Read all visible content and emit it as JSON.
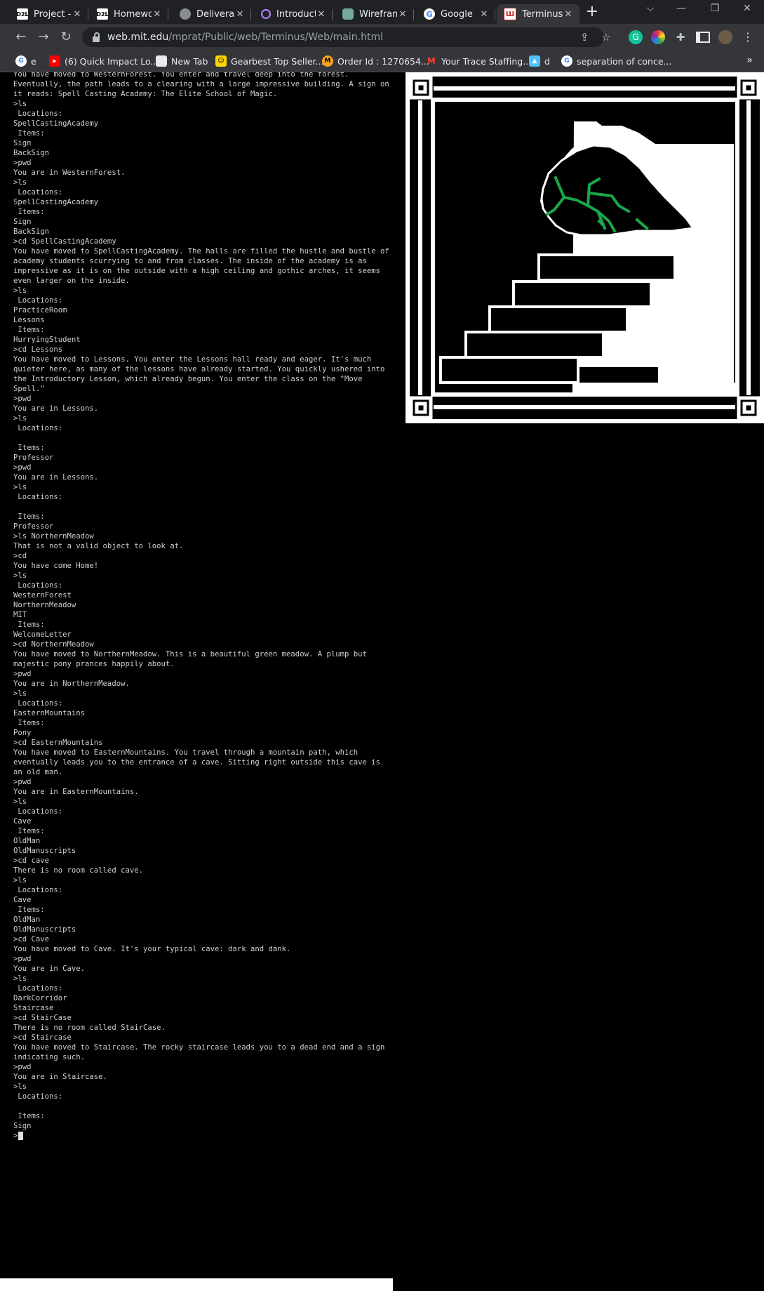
{
  "browser": {
    "tabs": [
      {
        "label": "Project - I",
        "favicon": "D2L",
        "active": false
      },
      {
        "label": "Homewo",
        "favicon": "D2L",
        "active": false
      },
      {
        "label": "Deliverab",
        "favicon": "globe-icon",
        "active": false
      },
      {
        "label": "Introducti",
        "favicon": "openai-icon",
        "active": false
      },
      {
        "label": "Wirefram",
        "favicon": "openai-icon",
        "active": false
      },
      {
        "label": "Google",
        "favicon": "google-icon",
        "active": false
      },
      {
        "label": "Terminus",
        "favicon": "terminus-icon",
        "active": true
      }
    ],
    "new_tab": "+",
    "url_host": "web.mit.edu",
    "url_path": "/mprat/Public/web/Terminus/Web/main.html",
    "bookmarks": [
      {
        "label": "e",
        "icon": "google-icon"
      },
      {
        "label": "(6) Quick Impact Lo...",
        "icon": "youtube-icon"
      },
      {
        "label": "New Tab",
        "icon": "page-icon"
      },
      {
        "label": "Gearbest Top Seller...",
        "icon": "gearbest-icon"
      },
      {
        "label": "Order Id : 1270654...",
        "icon": "m-icon"
      },
      {
        "label": "Your Trace Staffing...",
        "icon": "gmail-icon"
      },
      {
        "label": "d",
        "icon": "hat-icon"
      },
      {
        "label": "separation of conce...",
        "icon": "google-icon"
      }
    ],
    "bookmarks_more": "»",
    "colors": {
      "tabstrip": "#202124",
      "toolbar": "#35363a",
      "accent_green": "#1aa64a"
    }
  },
  "terminal": {
    "lines": [
      "You have moved to WesternForest. You enter and travel deep into the forest. Eventually, the path leads to a clearing with a large impressive building. A sign on it reads: Spell Casting Academy: The Elite School of Magic.",
      ">ls",
      " Locations:",
      "SpellCastingAcademy",
      " Items:",
      "Sign",
      "BackSign",
      ">pwd",
      "You are in WesternForest.",
      ">ls",
      " Locations:",
      "SpellCastingAcademy",
      " Items:",
      "Sign",
      "BackSign",
      ">cd SpellCastingAcademy",
      "You have moved to SpellCastingAcademy. The halls are filled the hustle and bustle of academy students scurrying to and from classes. The inside of the academy is as impressive as it is on the outside with a high ceiling and gothic arches, it seems even larger on the inside.",
      ">ls",
      " Locations:",
      "PracticeRoom",
      "Lessons",
      " Items:",
      "HurryingStudent",
      ">cd Lessons",
      "You have moved to Lessons. You enter the Lessons hall ready and eager. It's much quieter here, as many of the lessons have already started. You quickly ushered into the Introductory Lesson, which already begun. You enter the class on the \"Move Spell.\"",
      ">pwd",
      "You are in Lessons.",
      ">ls",
      " Locations:",
      "",
      " Items:",
      "Professor",
      ">pwd",
      "You are in Lessons.",
      ">ls",
      " Locations:",
      "",
      " Items:",
      "Professor",
      ">ls NorthernMeadow",
      "That is not a valid object to look at.",
      ">cd",
      "You have come Home!",
      ">ls",
      " Locations:",
      "WesternForest",
      "NorthernMeadow",
      "MIT",
      " Items:",
      "WelcomeLetter",
      ">cd NorthernMeadow",
      "You have moved to NorthernMeadow. This is a beautiful green meadow. A plump but majestic pony prances happily about.",
      ">pwd",
      "You are in NorthernMeadow.",
      ">ls",
      " Locations:",
      "EasternMountains",
      " Items:",
      "Pony",
      ">cd EasternMountains",
      "You have moved to EasternMountains. You travel through a mountain path, which eventually leads you to the entrance of a cave. Sitting right outside this cave is an old man.",
      ">pwd",
      "You are in EasternMountains.",
      ">ls",
      " Locations:",
      "Cave",
      " Items:",
      "OldMan",
      "OldManuscripts",
      ">cd cave",
      "There is no room called cave.",
      ">ls",
      " Locations:",
      "Cave",
      " Items:",
      "OldMan",
      "OldManuscripts",
      ">cd Cave",
      "You have moved to Cave. It's your typical cave: dark and dank.",
      ">pwd",
      "You are in Cave.",
      ">ls",
      " Locations:",
      "DarkCorridor",
      "Staircase",
      ">cd StairCase",
      "There is no room called StairCase.",
      ">cd Staircase",
      "You have moved to Staircase. The rocky staircase leads you to a dead end and a sign indicating such.",
      ">pwd",
      "You are in Staircase.",
      ">ls",
      " Locations:",
      "",
      " Items:",
      "Sign"
    ],
    "prompt": ">"
  },
  "art": {
    "image_name": "staircase-pixel-art",
    "colors": {
      "frame": "#ffffff",
      "bg": "#000000",
      "moss": "#1aa64a"
    }
  }
}
